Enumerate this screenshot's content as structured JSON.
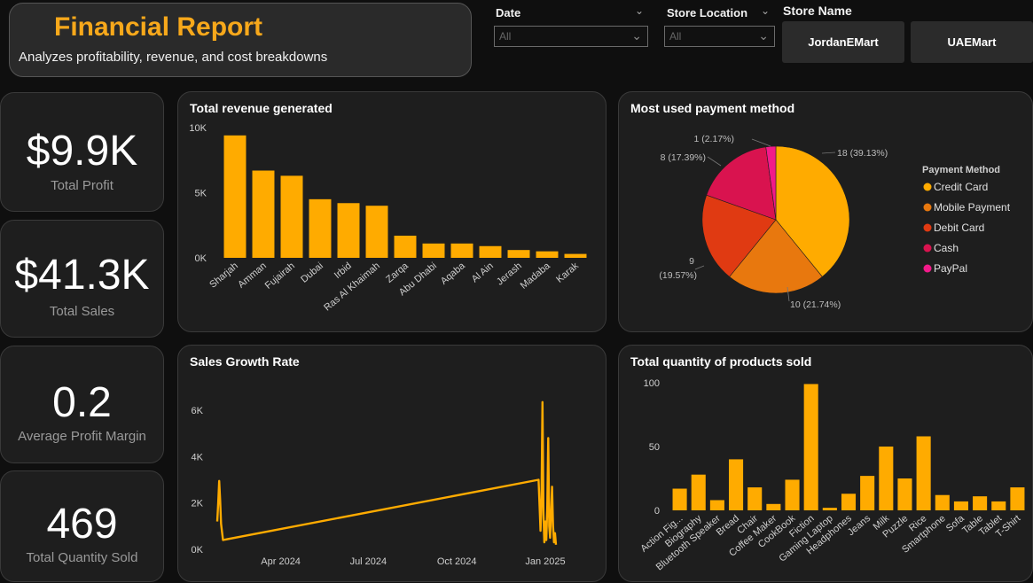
{
  "header": {
    "title": "Financial Report",
    "subtitle": "Analyzes profitability, revenue, and cost breakdowns"
  },
  "filters": {
    "date": {
      "label": "Date",
      "value": "All"
    },
    "store_location": {
      "label": "Store Location",
      "value": "All"
    },
    "store_name": {
      "label": "Store Name",
      "buttons": [
        "JordanEMart",
        "UAEMart"
      ]
    }
  },
  "kpis": [
    {
      "value": "$9.9K",
      "label": "Total Profit"
    },
    {
      "value": "$41.3K",
      "label": "Total Sales"
    },
    {
      "value": "0.2",
      "label": "Average Profit Margin"
    },
    {
      "value": "469",
      "label": "Total Quantity Sold"
    }
  ],
  "colors": {
    "accent": "#f7a81b",
    "bar": "#ffab00",
    "panel": "#1e1e1e"
  },
  "chart_data": [
    {
      "type": "bar",
      "title": "Total revenue generated",
      "categories": [
        "Sharjah",
        "Amman",
        "Fujairah",
        "Dubai",
        "Irbid",
        "Ras Al Khaimah",
        "Zarqa",
        "Abu Dhabi",
        "Aqaba",
        "Al Ain",
        "Jerash",
        "Madaba",
        "Karak"
      ],
      "values": [
        9400,
        6700,
        6300,
        4500,
        4200,
        4000,
        1700,
        1100,
        1100,
        900,
        600,
        500,
        300
      ],
      "yticks": [
        "0K",
        "5K",
        "10K"
      ],
      "ylim": [
        0,
        10000
      ],
      "xlabel": "",
      "ylabel": ""
    },
    {
      "type": "pie",
      "title": "Most used payment method",
      "legend_title": "Payment Method",
      "legend_position": "right",
      "slices": [
        {
          "name": "Credit Card",
          "value": 18,
          "label": "18 (39.13%)",
          "color": "#ffab00"
        },
        {
          "name": "Mobile Payment",
          "value": 10,
          "label": "10 (21.74%)",
          "color": "#e8780e"
        },
        {
          "name": "Debit Card",
          "value": 9,
          "label": "9 (19.57%)",
          "color": "#e03a12"
        },
        {
          "name": "Cash",
          "value": 8,
          "label": "8 (17.39%)",
          "color": "#d9134f"
        },
        {
          "name": "PayPal",
          "value": 1,
          "label": "1 (2.17%)",
          "color": "#f21a8a"
        }
      ]
    },
    {
      "type": "line",
      "title": "Sales Growth Rate",
      "yticks": [
        "0K",
        "2K",
        "4K",
        "6K"
      ],
      "ylim": [
        0,
        6800
      ],
      "xticks": [
        "Apr 2024",
        "Jul 2024",
        "Oct 2024",
        "Jan 2025"
      ],
      "xlim": [
        "2024-01-26",
        "2025-02-05"
      ],
      "points": [
        [
          "2024-01-26",
          1200
        ],
        [
          "2024-01-27",
          2000
        ],
        [
          "2024-01-28",
          2950
        ],
        [
          "2024-01-29",
          2100
        ],
        [
          "2024-01-30",
          1100
        ],
        [
          "2024-02-01",
          400
        ],
        [
          "2024-12-25",
          3000
        ],
        [
          "2024-12-27",
          800
        ],
        [
          "2024-12-28",
          2200
        ],
        [
          "2024-12-29",
          6350
        ],
        [
          "2024-12-30",
          1500
        ],
        [
          "2024-12-31",
          300
        ],
        [
          "2025-01-01",
          1200
        ],
        [
          "2025-01-02",
          400
        ],
        [
          "2025-01-03",
          1800
        ],
        [
          "2025-01-04",
          4800
        ],
        [
          "2025-01-05",
          1000
        ],
        [
          "2025-01-06",
          500
        ],
        [
          "2025-01-07",
          1600
        ],
        [
          "2025-01-08",
          2700
        ],
        [
          "2025-01-09",
          1000
        ],
        [
          "2025-01-10",
          300
        ],
        [
          "2025-01-11",
          700
        ],
        [
          "2025-01-12",
          200
        ]
      ]
    },
    {
      "type": "bar",
      "title": "Total quantity of products sold",
      "categories": [
        "Action Fig...",
        "Biography",
        "Bluetooth Speaker",
        "Bread",
        "Chair",
        "Coffee Maker",
        "CookBook",
        "Fiction",
        "Gaming Laptop",
        "Headphones",
        "Jeans",
        "Milk",
        "Puzzle",
        "Rice",
        "Smartphone",
        "Sofa",
        "Table",
        "Tablet",
        "T-Shirt"
      ],
      "values": [
        17,
        28,
        8,
        40,
        18,
        5,
        24,
        99,
        2,
        13,
        27,
        50,
        25,
        58,
        12,
        7,
        11,
        7,
        18
      ],
      "yticks": [
        "0",
        "50",
        "100"
      ],
      "ylim": [
        0,
        100
      ],
      "xlabel": "",
      "ylabel": ""
    }
  ]
}
